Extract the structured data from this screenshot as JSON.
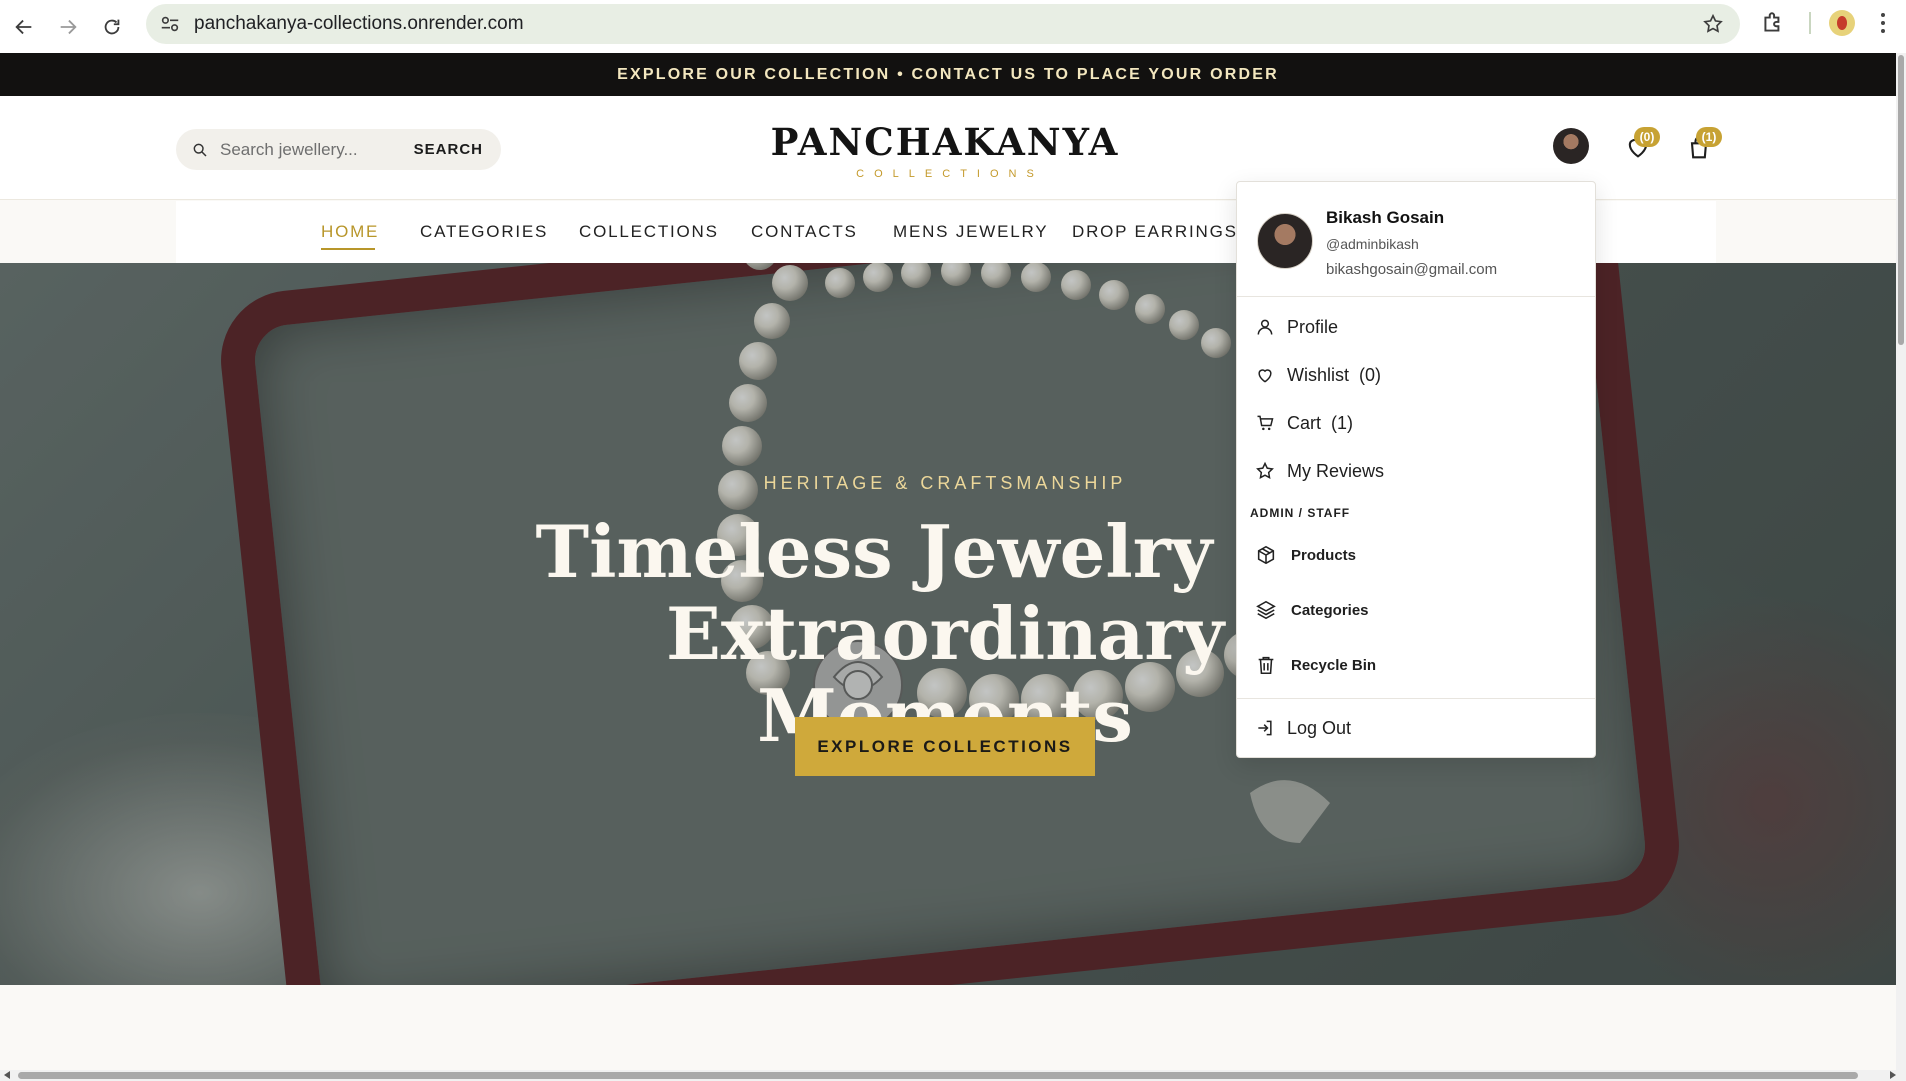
{
  "browser": {
    "url": "panchakanya-collections.onrender.com"
  },
  "announcement": "EXPLORE OUR COLLECTION • CONTACT US TO PLACE YOUR ORDER",
  "header": {
    "search_placeholder": "Search jewellery...",
    "search_button": "SEARCH",
    "logo_title": "PANCHAKANYA",
    "logo_subtitle": "COLLECTIONS",
    "wishlist_count": "(0)",
    "cart_count": "(1)"
  },
  "nav": {
    "items": [
      "HOME",
      "CATEGORIES",
      "COLLECTIONS",
      "CONTACTS",
      "MENS JEWELRY",
      "DROP EARRINGS"
    ],
    "active": "HOME"
  },
  "hero": {
    "kicker": "HERITAGE & CRAFTSMANSHIP",
    "title_line1": "Timeless Jewelry for",
    "title_line2": "Extraordinary Moments",
    "cta": "EXPLORE COLLECTIONS"
  },
  "user_menu": {
    "name": "Bikash Gosain",
    "username": "@adminbikash",
    "email": "bikashgosain@gmail.com",
    "items": {
      "profile": "Profile",
      "wishlist": "Wishlist",
      "wishlist_count": "(0)",
      "cart": "Cart",
      "cart_count": "(1)",
      "reviews": "My Reviews"
    },
    "admin_section": "ADMIN / STAFF",
    "admin_items": {
      "products": "Products",
      "categories": "Categories",
      "recycle_bin": "Recycle Bin"
    },
    "logout": "Log Out"
  },
  "colors": {
    "accent_gold": "#c7a233",
    "announcement_bg": "#121110",
    "cta_bg": "#cfa93b"
  }
}
